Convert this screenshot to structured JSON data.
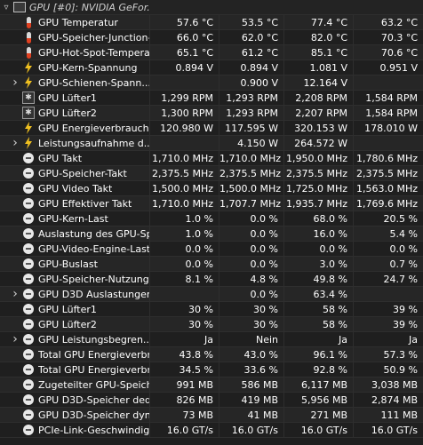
{
  "header": {
    "label": "GPU [#0]: NVIDIA GeFor..."
  },
  "rows": [
    {
      "icon": "thermometer-icon",
      "label": "GPU Temperatur",
      "v": [
        "57.6 °C",
        "53.5 °C",
        "77.4 °C",
        "63.2 °C"
      ]
    },
    {
      "icon": "thermometer-icon",
      "label": "GPU-Speicher-Junction-T...",
      "v": [
        "66.0 °C",
        "62.0 °C",
        "82.0 °C",
        "70.3 °C"
      ]
    },
    {
      "icon": "thermometer-icon",
      "label": "GPU-Hot-Spot-Temperatur",
      "v": [
        "65.1 °C",
        "61.2 °C",
        "85.1 °C",
        "70.6 °C"
      ]
    },
    {
      "icon": "lightning-icon",
      "label": "GPU-Kern-Spannung",
      "v": [
        "0.894 V",
        "0.894 V",
        "1.081 V",
        "0.951 V"
      ]
    },
    {
      "icon": "lightning-icon",
      "label": "GPU-Schienen-Spann...",
      "v": [
        "",
        "0.900 V",
        "12.164 V",
        ""
      ],
      "sub": true
    },
    {
      "icon": "fan-icon",
      "label": "GPU Lüfter1",
      "v": [
        "1,299 RPM",
        "1,293 RPM",
        "2,208 RPM",
        "1,584 RPM"
      ]
    },
    {
      "icon": "fan-icon",
      "label": "GPU Lüfter2",
      "v": [
        "1,300 RPM",
        "1,293 RPM",
        "2,207 RPM",
        "1,584 RPM"
      ]
    },
    {
      "icon": "lightning-icon",
      "label": "GPU Energieverbrauch",
      "v": [
        "120.980 W",
        "117.595 W",
        "320.153 W",
        "178.010 W"
      ]
    },
    {
      "icon": "lightning-icon",
      "label": "Leistungsaufnahme d...",
      "v": [
        "",
        "4.150 W",
        "264.572 W",
        ""
      ],
      "sub": true
    },
    {
      "icon": "clock-icon",
      "label": "GPU Takt",
      "v": [
        "1,710.0 MHz",
        "1,710.0 MHz",
        "1,950.0 MHz",
        "1,780.6 MHz"
      ]
    },
    {
      "icon": "clock-icon",
      "label": "GPU-Speicher-Takt",
      "v": [
        "2,375.5 MHz",
        "2,375.5 MHz",
        "2,375.5 MHz",
        "2,375.5 MHz"
      ]
    },
    {
      "icon": "clock-icon",
      "label": "GPU Video Takt",
      "v": [
        "1,500.0 MHz",
        "1,500.0 MHz",
        "1,725.0 MHz",
        "1,563.0 MHz"
      ]
    },
    {
      "icon": "clock-icon",
      "label": "GPU Effektiver Takt",
      "v": [
        "1,710.0 MHz",
        "1,707.7 MHz",
        "1,935.7 MHz",
        "1,769.6 MHz"
      ]
    },
    {
      "icon": "clock-icon",
      "label": "GPU-Kern-Last",
      "v": [
        "1.0 %",
        "0.0 %",
        "68.0 %",
        "20.5 %"
      ]
    },
    {
      "icon": "clock-icon",
      "label": "Auslastung des GPU-Spe...",
      "v": [
        "1.0 %",
        "0.0 %",
        "16.0 %",
        "5.4 %"
      ]
    },
    {
      "icon": "clock-icon",
      "label": "GPU-Video-Engine-Last",
      "v": [
        "0.0 %",
        "0.0 %",
        "0.0 %",
        "0.0 %"
      ]
    },
    {
      "icon": "clock-icon",
      "label": "GPU-Buslast",
      "v": [
        "0.0 %",
        "0.0 %",
        "3.0 %",
        "0.7 %"
      ]
    },
    {
      "icon": "clock-icon",
      "label": "GPU-Speicher-Nutzung",
      "v": [
        "8.1 %",
        "4.8 %",
        "49.8 %",
        "24.7 %"
      ]
    },
    {
      "icon": "clock-icon",
      "label": "GPU D3D Auslastungen",
      "v": [
        "",
        "0.0 %",
        "63.4 %",
        ""
      ],
      "sub": true
    },
    {
      "icon": "clock-icon",
      "label": "GPU Lüfter1",
      "v": [
        "30 %",
        "30 %",
        "58 %",
        "39 %"
      ]
    },
    {
      "icon": "clock-icon",
      "label": "GPU Lüfter2",
      "v": [
        "30 %",
        "30 %",
        "58 %",
        "39 %"
      ]
    },
    {
      "icon": "clock-icon",
      "label": "GPU Leistungsbegren...",
      "v": [
        "Ja",
        "Nein",
        "Ja",
        "Ja"
      ],
      "sub": true
    },
    {
      "icon": "clock-icon",
      "label": "Total GPU Energieverbra...",
      "v": [
        "43.8 %",
        "43.0 %",
        "96.1 %",
        "57.3 %"
      ]
    },
    {
      "icon": "clock-icon",
      "label": "Total GPU Energieverbra...",
      "v": [
        "34.5 %",
        "33.6 %",
        "92.8 %",
        "50.9 %"
      ]
    },
    {
      "icon": "clock-icon",
      "label": "Zugeteilter GPU-Speicher",
      "v": [
        "991 MB",
        "586 MB",
        "6,117 MB",
        "3,038 MB"
      ]
    },
    {
      "icon": "clock-icon",
      "label": "GPU D3D-Speicher dedizi...",
      "v": [
        "826 MB",
        "419 MB",
        "5,956 MB",
        "2,874 MB"
      ]
    },
    {
      "icon": "clock-icon",
      "label": "GPU D3D-Speicher dyna...",
      "v": [
        "73 MB",
        "41 MB",
        "271 MB",
        "111 MB"
      ]
    },
    {
      "icon": "clock-icon",
      "label": "PCIe-Link-Geschwindigkeit",
      "v": [
        "16.0 GT/s",
        "16.0 GT/s",
        "16.0 GT/s",
        "16.0 GT/s"
      ]
    }
  ]
}
